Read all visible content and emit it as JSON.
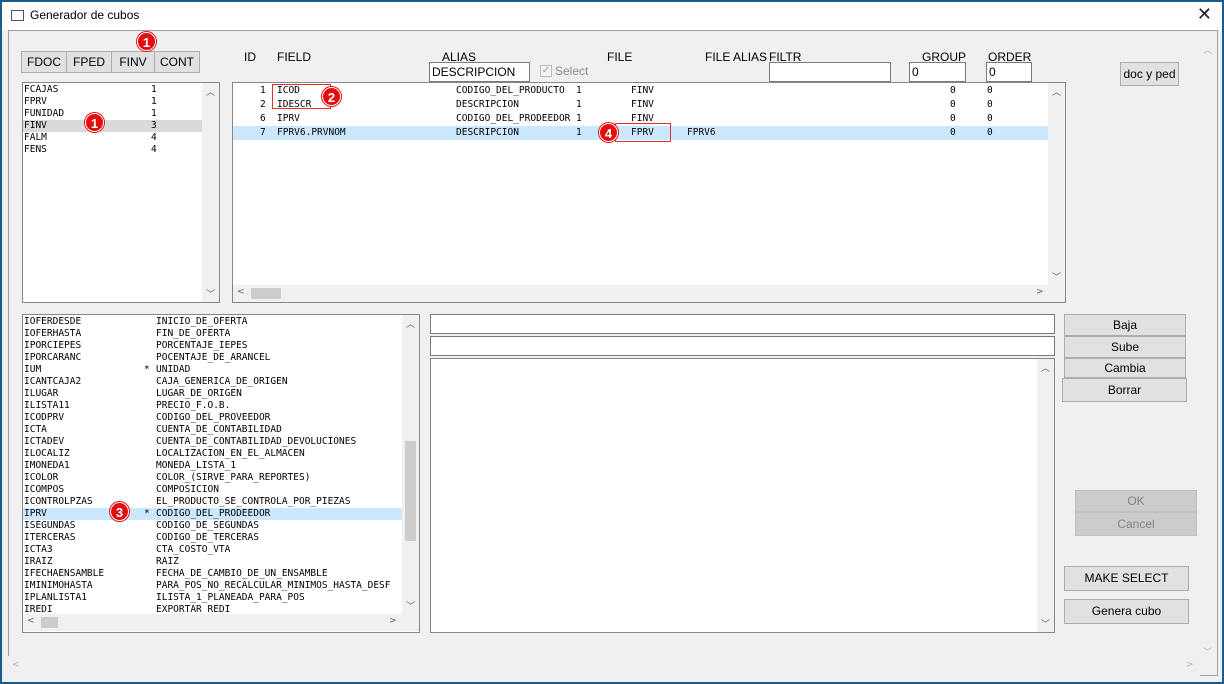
{
  "window": {
    "title": "Generador de cubos",
    "close": "✕"
  },
  "tabs": [
    "FDOC",
    "FPED",
    "FINV",
    "CONT"
  ],
  "markers": [
    "1",
    "1",
    "2",
    "3",
    "4"
  ],
  "tables_list": [
    {
      "name": "FCAJAS",
      "count": "1"
    },
    {
      "name": "FPRV",
      "count": "1"
    },
    {
      "name": "FUNIDAD",
      "count": "1"
    },
    {
      "name": "FINV",
      "count": "3"
    },
    {
      "name": "FALM",
      "count": "4"
    },
    {
      "name": "FENS",
      "count": "4"
    }
  ],
  "grid_headers": {
    "id": "ID",
    "field": "FIELD",
    "alias": "ALIAS",
    "file": "FILE",
    "file_alias": "FILE ALIAS",
    "filtr": "FILTR",
    "group": "GROUP",
    "order": "ORDER"
  },
  "grid_inputs": {
    "alias_value": "DESCRIPCION",
    "select_label": "Select",
    "filtr_value": "",
    "group_value": "0",
    "order_value": "0"
  },
  "grid_rows": [
    {
      "id": "1",
      "field": "ICOD",
      "alias": "CODIGO_DEL_PRODUCTO",
      "sel": "1",
      "file": "FINV",
      "file_alias": "",
      "group": "0",
      "order": "0"
    },
    {
      "id": "2",
      "field": "IDESCR",
      "alias": "DESCRIPCION",
      "sel": "1",
      "file": "FINV",
      "file_alias": "",
      "group": "0",
      "order": "0"
    },
    {
      "id": "6",
      "field": "IPRV",
      "alias": "CODIGO_DEL_PRODEEDOR",
      "sel": "1",
      "file": "FINV",
      "file_alias": "",
      "group": "0",
      "order": "0"
    },
    {
      "id": "7",
      "field": "FPRV6.PRVNOM",
      "alias": "DESCRIPCION",
      "sel": "1",
      "file": "FPRV",
      "file_alias": "FPRV6",
      "group": "0",
      "order": "0"
    }
  ],
  "doc_ped_button": "doc y ped",
  "fields_list": [
    {
      "name": "IOFERDESDE",
      "flag": "",
      "desc": "INICIO_DE_OFERTA"
    },
    {
      "name": "IOFERHASTA",
      "flag": "",
      "desc": "FIN_DE_OFERTA"
    },
    {
      "name": "IPORCIEPES",
      "flag": "",
      "desc": "PORCENTAJE_IEPES"
    },
    {
      "name": "IPORCARANC",
      "flag": "",
      "desc": "POCENTAJE_DE_ARANCEL"
    },
    {
      "name": "IUM",
      "flag": "*",
      "desc": "UNIDAD"
    },
    {
      "name": "ICANTCAJA2",
      "flag": "",
      "desc": "CAJA_GENERICA_DE_ORIGEN"
    },
    {
      "name": "ILUGAR",
      "flag": "",
      "desc": "LUGAR_DE_ORIGEN"
    },
    {
      "name": "ILISTA11",
      "flag": "",
      "desc": "PRECIO_F.O.B."
    },
    {
      "name": "ICODPRV",
      "flag": "",
      "desc": "CODIGO_DEL_PROVEEDOR"
    },
    {
      "name": "ICTA",
      "flag": "",
      "desc": "CUENTA_DE_CONTABILIDAD"
    },
    {
      "name": "ICTADEV",
      "flag": "",
      "desc": "CUENTA_DE_CONTABILIDAD_DEVOLUCIONES"
    },
    {
      "name": "ILOCALIZ",
      "flag": "",
      "desc": "LOCALIZACION_EN_EL_ALMACEN"
    },
    {
      "name": "IMONEDA1",
      "flag": "",
      "desc": "MONEDA_LISTA_1"
    },
    {
      "name": "ICOLOR",
      "flag": "",
      "desc": "COLOR_(SIRVE_PARA_REPORTES)"
    },
    {
      "name": "ICOMPOS",
      "flag": "",
      "desc": "COMPOSICION"
    },
    {
      "name": "ICONTROLPZAS",
      "flag": "",
      "desc": "EL_PRODUCTO_SE_CONTROLA_POR_PIEZAS"
    },
    {
      "name": "IPRV",
      "flag": "*",
      "desc": "CODIGO_DEL_PRODEEDOR"
    },
    {
      "name": "ISEGUNDAS",
      "flag": "",
      "desc": "CODIGO_DE_SEGUNDAS"
    },
    {
      "name": "ITERCERAS",
      "flag": "",
      "desc": "CODIGO_DE_TERCERAS"
    },
    {
      "name": "ICTA3",
      "flag": "",
      "desc": "CTA_COSTO_VTA"
    },
    {
      "name": "IRAIZ",
      "flag": "",
      "desc": "RAIZ"
    },
    {
      "name": "IFECHAENSAMBLE",
      "flag": "",
      "desc": "FECHA_DE_CAMBIO_DE_UN_ENSAMBLE"
    },
    {
      "name": "IMINIMOHASTA",
      "flag": "",
      "desc": "PARA_POS_NO_RECALCULAR_MINIMOS_HASTA_DESF"
    },
    {
      "name": "IPLANLISTA1",
      "flag": "",
      "desc": "ILISTA_1_PLANEADA_PARA_POS"
    },
    {
      "name": "IREDI",
      "flag": "",
      "desc": "EXPORTAR_REDI"
    }
  ],
  "side_buttons": {
    "baja": "Baja",
    "sube": "Sube",
    "cambia": "Cambia",
    "borrar": "Borrar",
    "ok": "OK",
    "cancel": "Cancel",
    "make_select": "MAKE SELECT",
    "genera_cubo": "Genera cubo"
  },
  "colors": {
    "selection": "#cce8ff",
    "marker": "#e20e0e",
    "window_border": "#1b5a8a"
  }
}
